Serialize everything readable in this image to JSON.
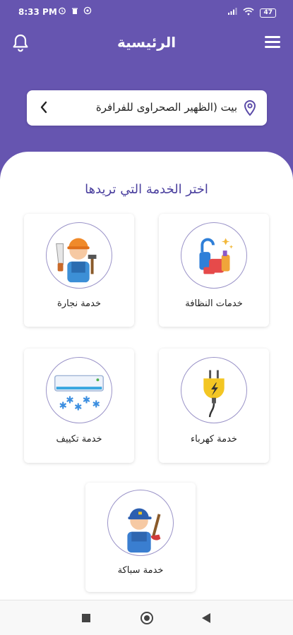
{
  "status_bar": {
    "time": "8:33 PM",
    "battery": "47"
  },
  "header": {
    "title": "الرئيسية"
  },
  "location": {
    "text": "بيت (الظهير الصحراوى للفرافرة"
  },
  "section": {
    "title": "اختر الخدمة التي تريدها"
  },
  "services": [
    {
      "label": "خدمات النظافة",
      "icon": "cleaning-icon"
    },
    {
      "label": "خدمة نجارة",
      "icon": "carpenter-icon"
    },
    {
      "label": "خدمة كهرباء",
      "icon": "electric-plug-icon"
    },
    {
      "label": "خدمة تكييف",
      "icon": "air-conditioner-icon"
    },
    {
      "label": "خدمة سباكة",
      "icon": "plumber-icon"
    }
  ],
  "colors": {
    "primary": "#6655b0",
    "accent_text": "#4a3f9e"
  }
}
